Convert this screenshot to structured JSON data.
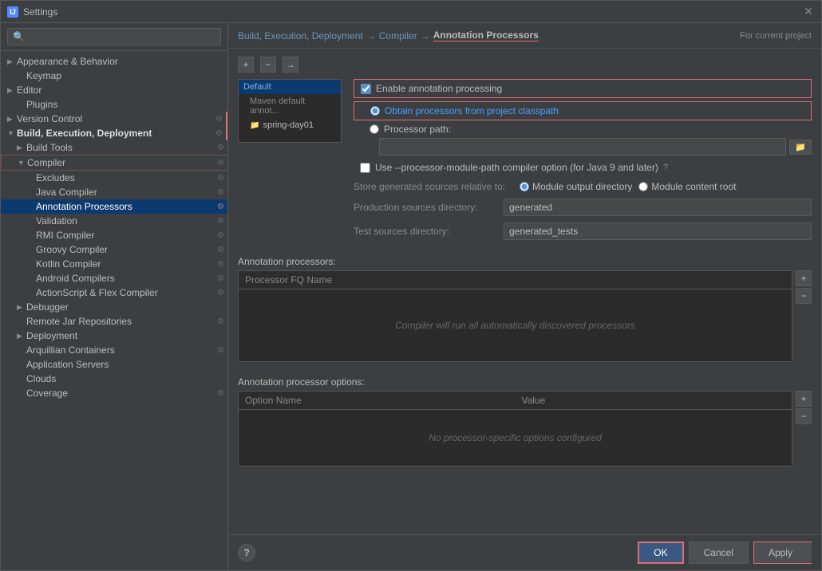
{
  "window": {
    "title": "Settings",
    "icon_label": "IJ"
  },
  "sidebar": {
    "search_placeholder": "🔍",
    "items": [
      {
        "id": "appearance-behavior",
        "label": "Appearance & Behavior",
        "indent": 0,
        "triangle": "closed",
        "highlighted": false
      },
      {
        "id": "keymap",
        "label": "Keymap",
        "indent": 1,
        "triangle": "none",
        "highlighted": false
      },
      {
        "id": "editor",
        "label": "Editor",
        "indent": 0,
        "triangle": "closed",
        "highlighted": false
      },
      {
        "id": "plugins",
        "label": "Plugins",
        "indent": 1,
        "triangle": "none",
        "highlighted": false
      },
      {
        "id": "version-control",
        "label": "Version Control",
        "indent": 0,
        "triangle": "closed",
        "highlighted": false
      },
      {
        "id": "build-execution",
        "label": "Build, Execution, Deployment",
        "indent": 0,
        "triangle": "open",
        "highlighted": true,
        "has_icon": true
      },
      {
        "id": "build-tools",
        "label": "Build Tools",
        "indent": 1,
        "triangle": "closed",
        "highlighted": false,
        "has_icon": true
      },
      {
        "id": "compiler",
        "label": "Compiler",
        "indent": 1,
        "triangle": "open",
        "highlighted": false,
        "has_icon": true,
        "border": true
      },
      {
        "id": "excludes",
        "label": "Excludes",
        "indent": 2,
        "triangle": "none",
        "highlighted": false,
        "has_icon": true
      },
      {
        "id": "java-compiler",
        "label": "Java Compiler",
        "indent": 2,
        "triangle": "none",
        "highlighted": false,
        "has_icon": true
      },
      {
        "id": "annotation-processors",
        "label": "Annotation Processors",
        "indent": 2,
        "triangle": "none",
        "highlighted": true,
        "selected": true,
        "has_icon": true
      },
      {
        "id": "validation",
        "label": "Validation",
        "indent": 2,
        "triangle": "none",
        "highlighted": false,
        "has_icon": true
      },
      {
        "id": "rmi-compiler",
        "label": "RMI Compiler",
        "indent": 2,
        "triangle": "none",
        "highlighted": false,
        "has_icon": true
      },
      {
        "id": "groovy-compiler",
        "label": "Groovy Compiler",
        "indent": 2,
        "triangle": "none",
        "highlighted": false,
        "has_icon": true
      },
      {
        "id": "kotlin-compiler",
        "label": "Kotlin Compiler",
        "indent": 2,
        "triangle": "none",
        "highlighted": false,
        "has_icon": true
      },
      {
        "id": "android-compilers",
        "label": "Android Compilers",
        "indent": 2,
        "triangle": "none",
        "highlighted": false,
        "has_icon": true
      },
      {
        "id": "actionscript-flex",
        "label": "ActionScript & Flex Compiler",
        "indent": 2,
        "triangle": "none",
        "highlighted": false,
        "has_icon": true
      },
      {
        "id": "debugger",
        "label": "Debugger",
        "indent": 1,
        "triangle": "closed",
        "highlighted": false
      },
      {
        "id": "remote-jar",
        "label": "Remote Jar Repositories",
        "indent": 1,
        "triangle": "none",
        "highlighted": false,
        "has_icon": true
      },
      {
        "id": "deployment",
        "label": "Deployment",
        "indent": 1,
        "triangle": "closed",
        "highlighted": false
      },
      {
        "id": "arquillian",
        "label": "Arquillian Containers",
        "indent": 1,
        "triangle": "none",
        "highlighted": false,
        "has_icon": true
      },
      {
        "id": "app-servers",
        "label": "Application Servers",
        "indent": 1,
        "triangle": "none",
        "highlighted": false
      },
      {
        "id": "clouds",
        "label": "Clouds",
        "indent": 1,
        "triangle": "none",
        "highlighted": false
      },
      {
        "id": "coverage",
        "label": "Coverage",
        "indent": 1,
        "triangle": "none",
        "highlighted": false,
        "has_icon": true
      }
    ]
  },
  "breadcrumb": {
    "parts": [
      "Build, Execution, Deployment",
      "Compiler",
      "Annotation Processors"
    ],
    "for_current": "For current project"
  },
  "toolbar": {
    "add_label": "+",
    "remove_label": "−",
    "navigate_label": "→"
  },
  "profiles": {
    "items": [
      {
        "id": "default",
        "label": "Default",
        "selected": true
      },
      {
        "id": "maven-default",
        "label": "Maven default annot...",
        "selected": false,
        "indent": true
      },
      {
        "id": "spring-day01",
        "label": "spring-day01",
        "selected": false,
        "indent": true
      }
    ]
  },
  "options": {
    "enable_annotation_processing": {
      "label": "Enable annotation processing",
      "checked": true
    },
    "obtain_processors": {
      "label": "Obtain processors from project classpath",
      "checked": true
    },
    "processor_path": {
      "label": "Processor path:",
      "checked": false,
      "value": ""
    },
    "use_processor_module_path": {
      "label": "Use --processor-module-path compiler option (for Java 9 and later)",
      "checked": false,
      "help": "?"
    },
    "store_generated": {
      "label": "Store generated sources relative to:",
      "radio1_label": "Module output directory",
      "radio1_selected": true,
      "radio2_label": "Module content root",
      "radio2_selected": false
    },
    "production_sources_dir": {
      "label": "Production sources directory:",
      "value": "generated"
    },
    "test_sources_dir": {
      "label": "Test sources directory:",
      "value": "generated_tests"
    }
  },
  "annotation_processors_table": {
    "header": "Annotation processors:",
    "col_processor": "Processor FQ Name",
    "empty_message": "Compiler will run all automatically discovered processors",
    "add_btn": "+",
    "remove_btn": "−"
  },
  "annotation_options_table": {
    "header": "Annotation processor options:",
    "col_option": "Option Name",
    "col_value": "Value",
    "empty_message": "No processor-specific options configured",
    "add_btn": "+",
    "remove_btn": "−"
  },
  "buttons": {
    "ok": "OK",
    "cancel": "Cancel",
    "apply": "Apply",
    "help": "?"
  }
}
